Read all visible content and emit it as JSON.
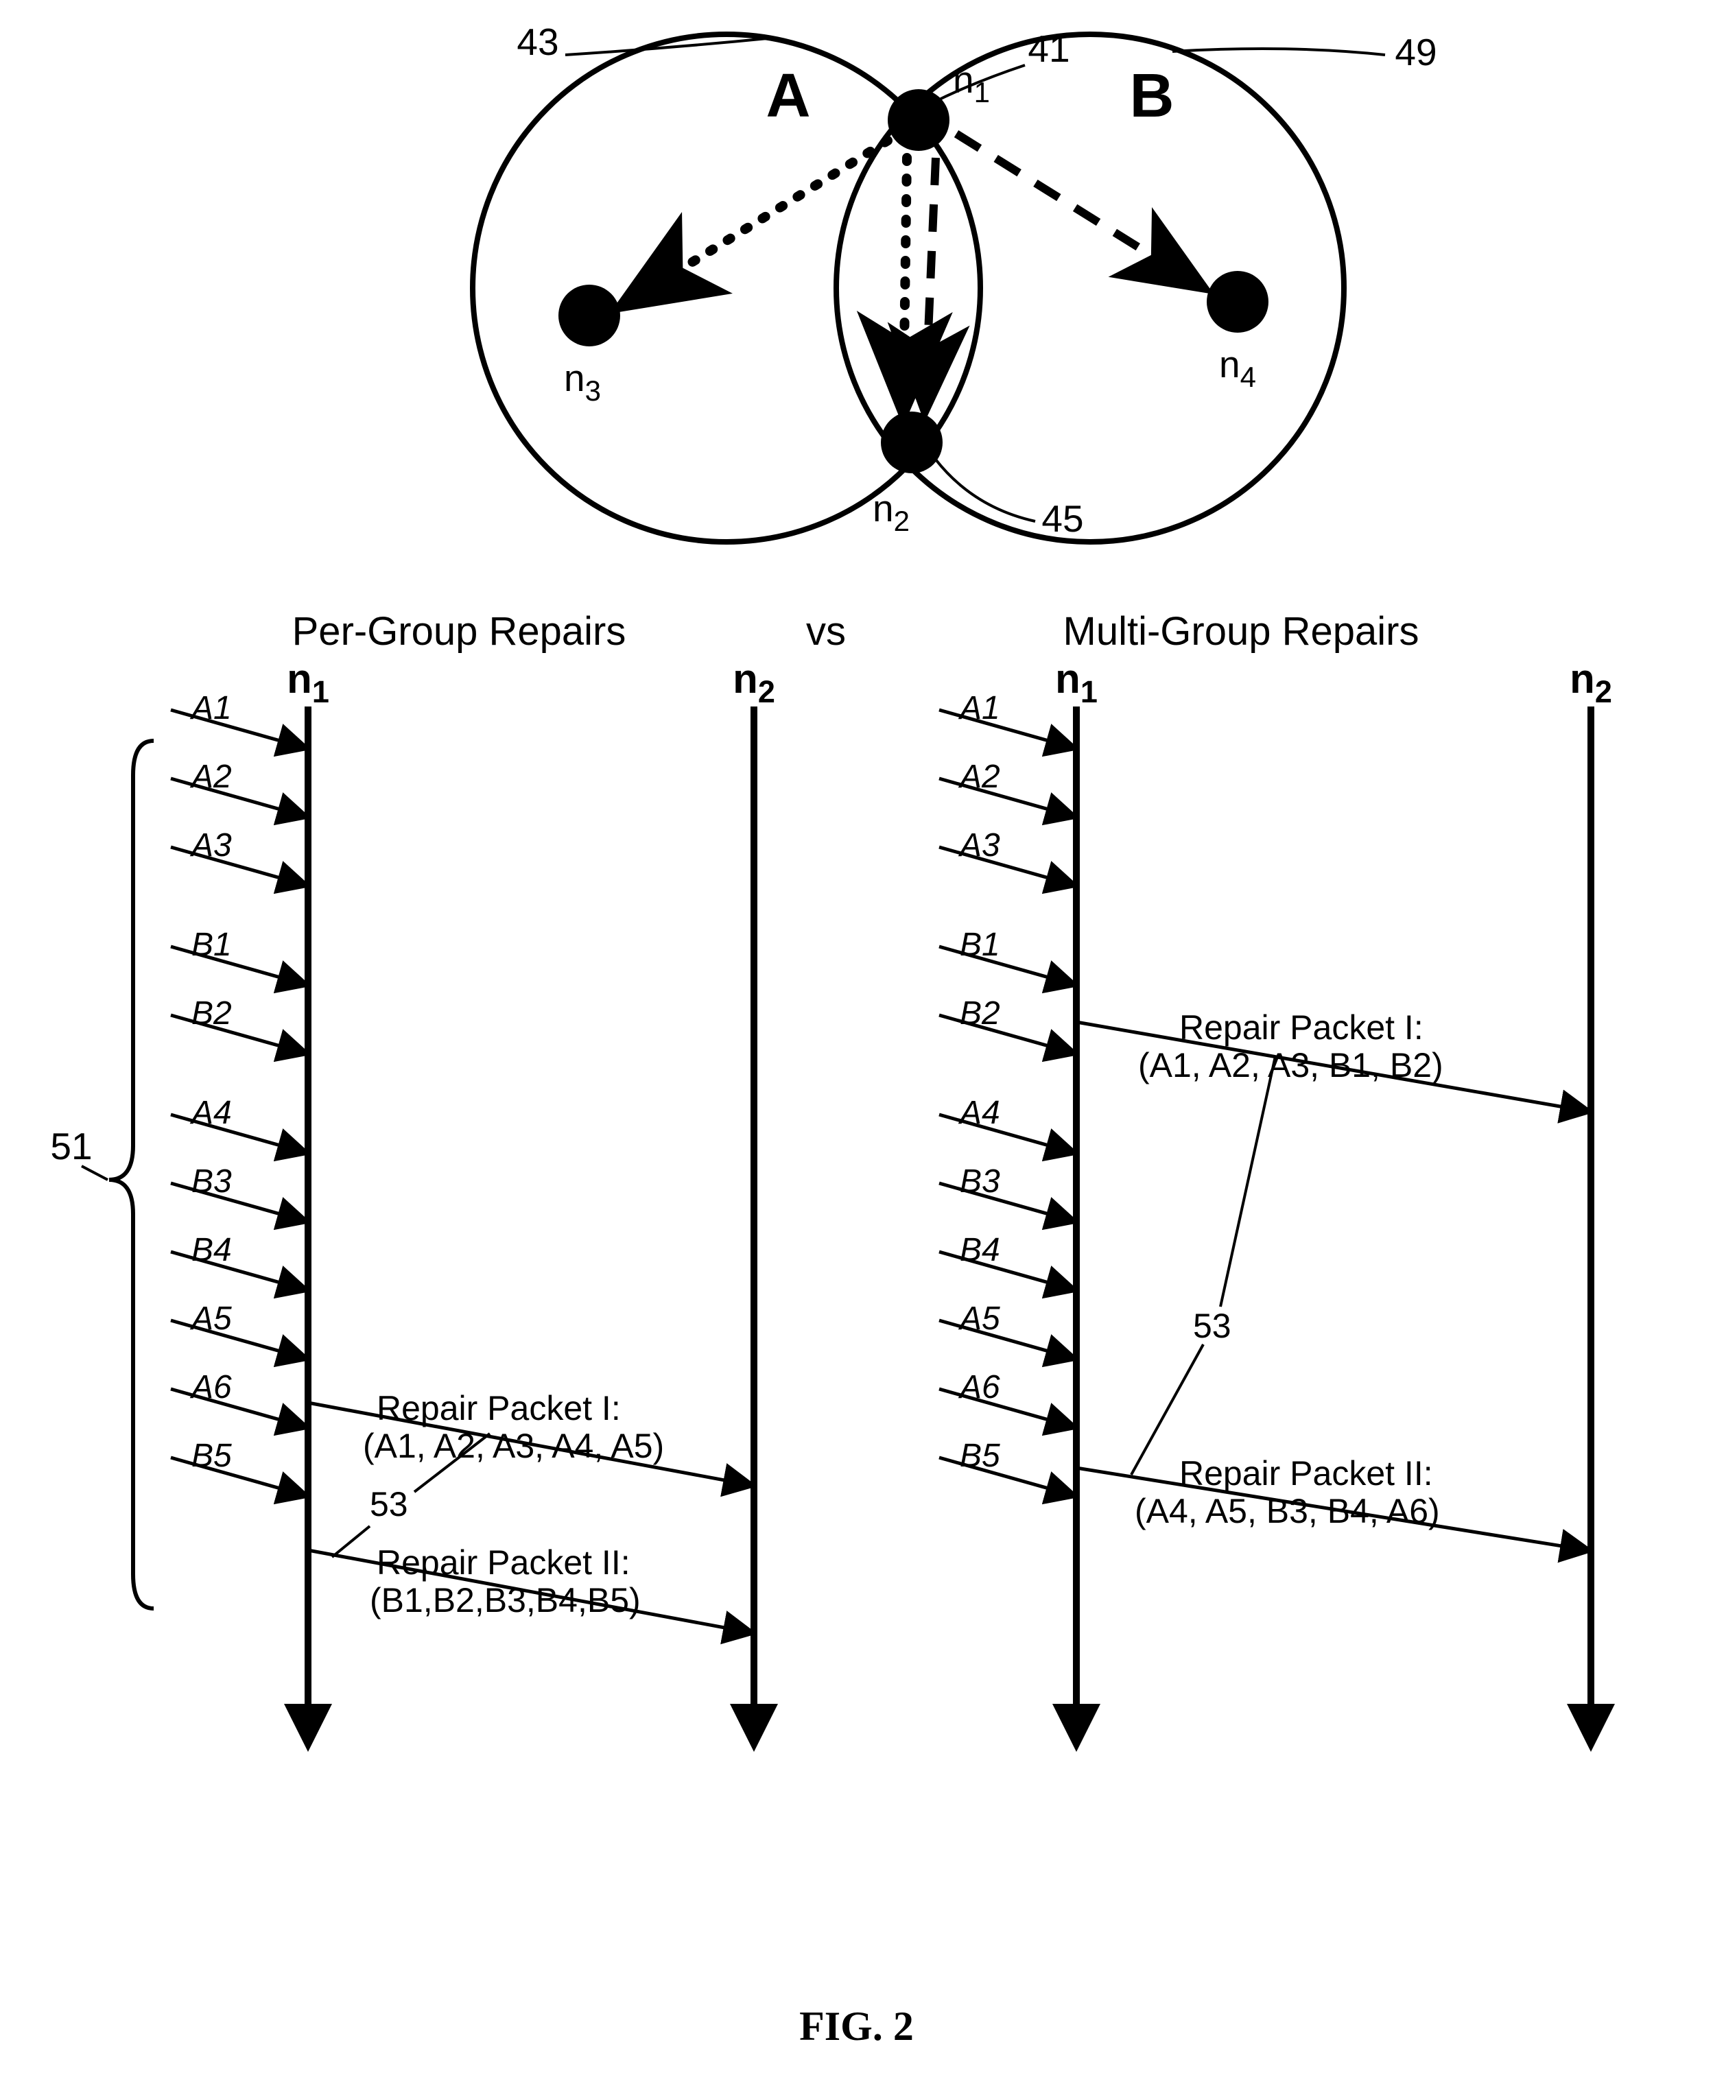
{
  "venn": {
    "labelA": "A",
    "labelB": "B",
    "ref43": "43",
    "ref49": "49",
    "ref41": "41",
    "ref45": "45",
    "n1": "n",
    "n1sub": "1",
    "n2": "n",
    "n2sub": "2",
    "n3": "n",
    "n3sub": "3",
    "n4": "n",
    "n4sub": "4"
  },
  "headers": {
    "left": "Per-Group Repairs",
    "vs": "vs",
    "right": "Multi-Group Repairs"
  },
  "timelineLabels": {
    "n1": "n",
    "n1sub": "1",
    "n2": "n",
    "n2sub": "2"
  },
  "ref51": "51",
  "ref53": "53",
  "packets": [
    "A1",
    "A2",
    "A3",
    "B1",
    "B2",
    "A4",
    "B3",
    "B4",
    "A5",
    "A6",
    "B5"
  ],
  "left": {
    "repair1_l1": "Repair Packet I:",
    "repair1_l2": "(A1, A2, A3, A4, A5)",
    "repair2_l1": "Repair Packet II:",
    "repair2_l2": "(B1,B2,B3,B4,B5)"
  },
  "right": {
    "repair1_l1": "Repair Packet I:",
    "repair1_l2": "(A1, A2, A3, B1, B2)",
    "repair2_l1": "Repair Packet II:",
    "repair2_l2": "(A4, A5, B3, B4, A6)"
  },
  "caption": "FIG. 2"
}
